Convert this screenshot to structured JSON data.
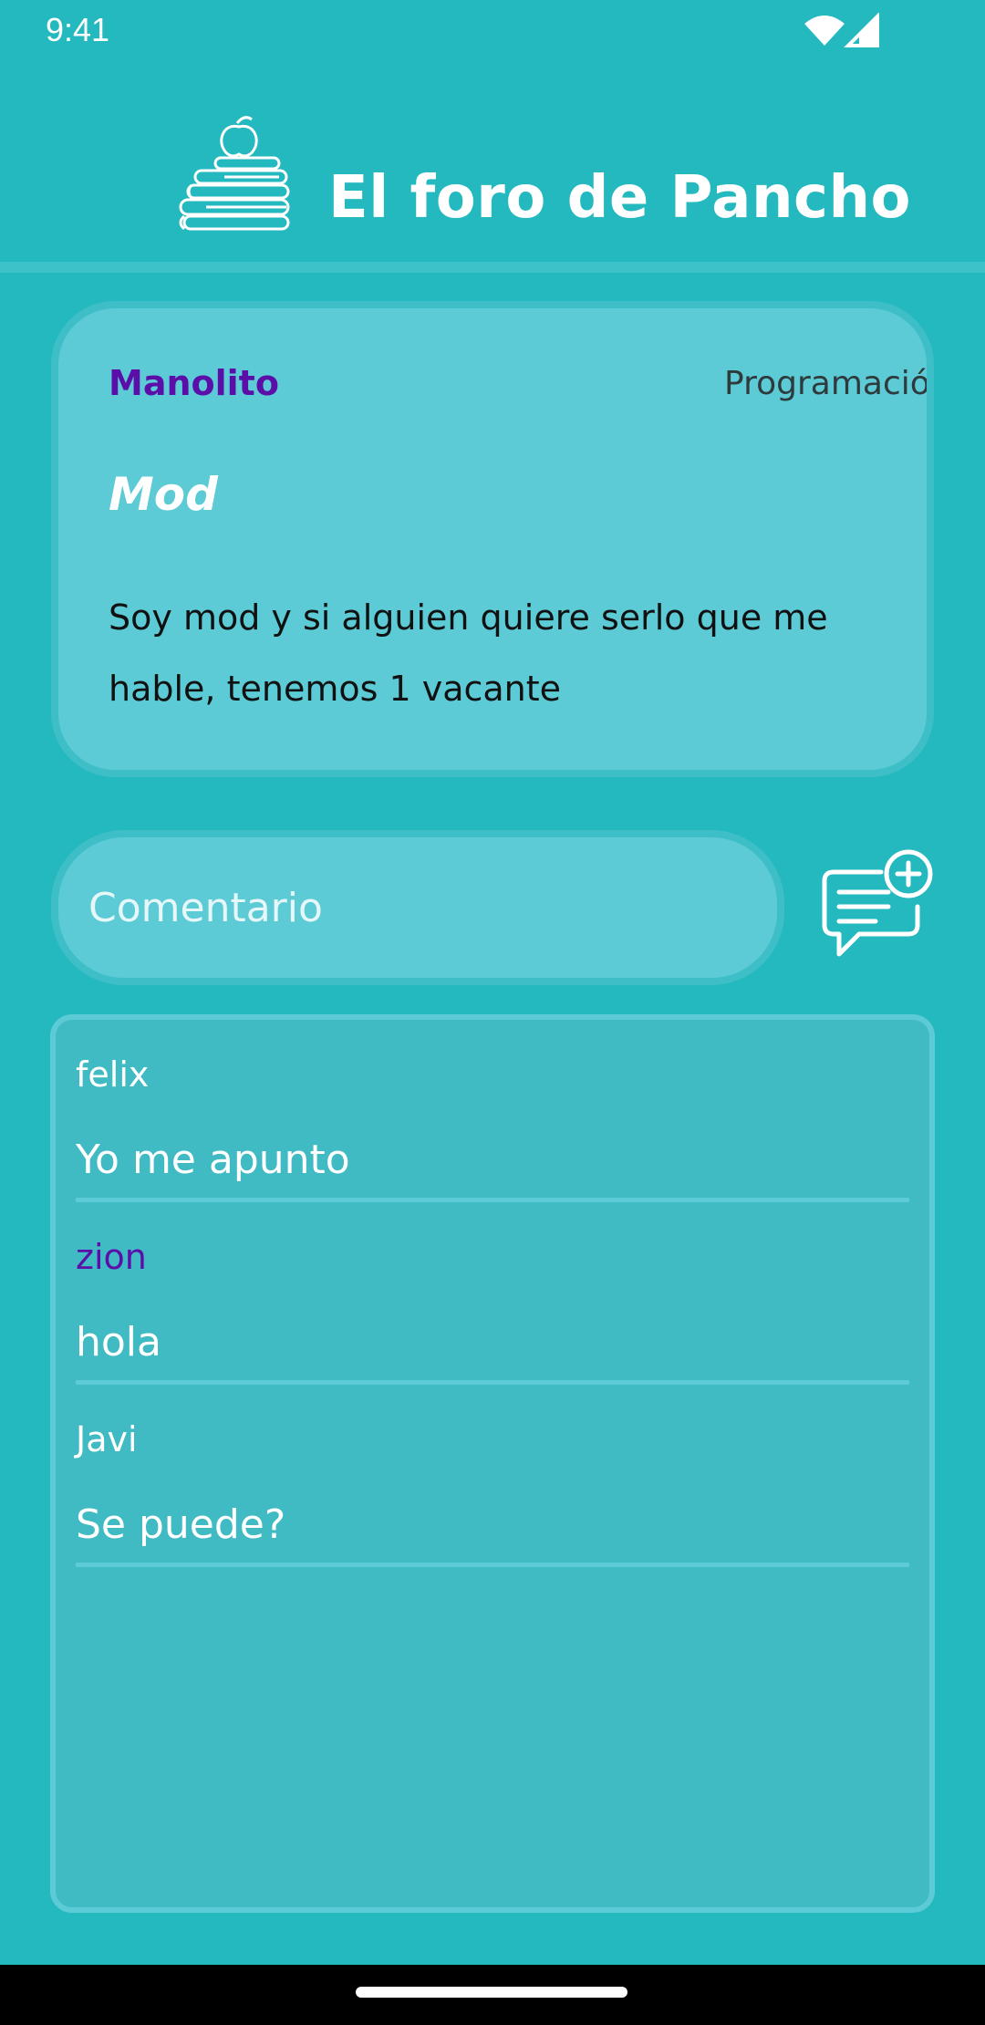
{
  "status_bar": {
    "time": "9:41",
    "icons": [
      "wifi-icon",
      "signal-icon"
    ]
  },
  "header": {
    "title": "El foro de Pancho",
    "logo": "books-apple-logo"
  },
  "post": {
    "author": "Manolito",
    "category": "Programación",
    "title": "Mod",
    "body": "Soy mod y si alguien quiere serlo que me hable, tenemos 1 vacante"
  },
  "comment_box": {
    "placeholder": "Comentario",
    "value": "",
    "add_button_icon": "add-comment-icon"
  },
  "comments": [
    {
      "author": "felix",
      "text": "Yo me apunto"
    },
    {
      "author": "zion",
      "text": "hola"
    },
    {
      "author": "Javi",
      "text": "Se puede?"
    }
  ],
  "colors": {
    "background": "#24b8bf",
    "card": "#5ccbd6",
    "panel": "#40bbc4",
    "accent_purple": "#5b0fa8",
    "text_white": "#ffffff"
  }
}
